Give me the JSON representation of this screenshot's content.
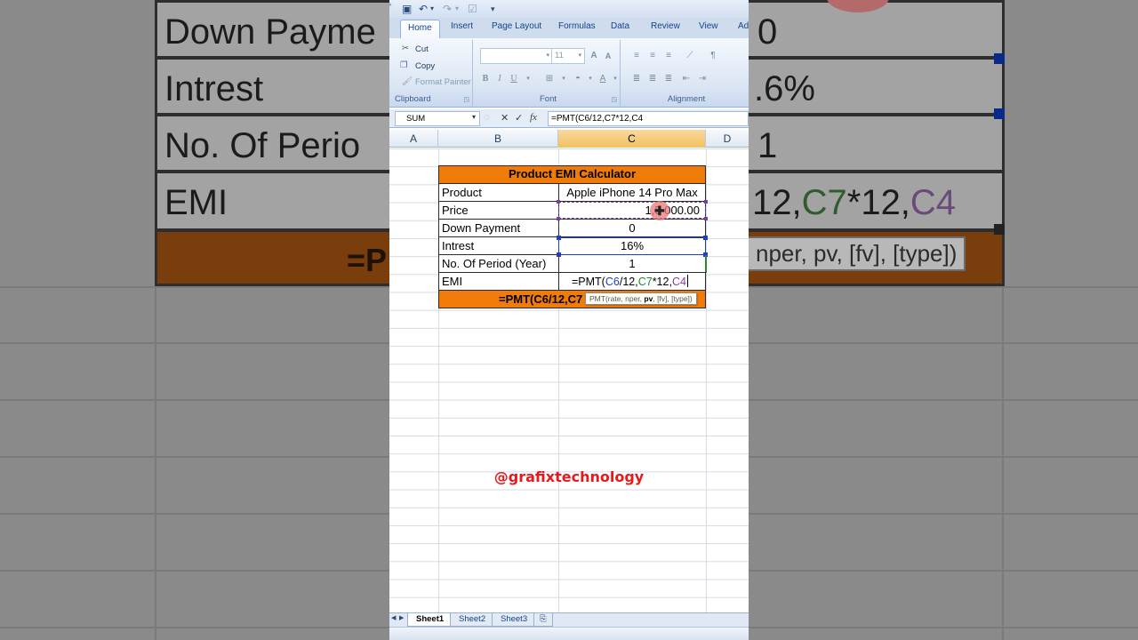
{
  "background_zoom": {
    "labels": [
      "Down Payme",
      "Intrest",
      "No. Of Perio",
      "EMI"
    ],
    "values": [
      "0",
      ".6%",
      "1"
    ],
    "formula_parts": {
      "a": "12,",
      "b": "C7",
      "c": "*12,",
      "d": "C4"
    },
    "tooltip": "nper, pv, [fv], [type])",
    "orange_text": "=P"
  },
  "qat": {
    "save_icon": "save-icon",
    "undo_icon": "undo-icon",
    "redo_icon": "redo-icon",
    "more": "▾"
  },
  "tabs": [
    "Home",
    "Insert",
    "Page Layout",
    "Formulas",
    "Data",
    "Review",
    "View",
    "Ad"
  ],
  "ribbon": {
    "clipboard": {
      "cut": "Cut",
      "copy": "Copy",
      "format_painter": "Format Painter",
      "label": "Clipboard"
    },
    "font": {
      "size": "11",
      "label": "Font",
      "grow": "A",
      "shrink": "A",
      "bold": "B",
      "italic": "I",
      "underline": "U"
    },
    "alignment": {
      "label": "Alignment"
    }
  },
  "formula_bar": {
    "name_box": "SUM",
    "formula": "=PMT(C6/12,C7*12,C4"
  },
  "columns": [
    "A",
    "B",
    "C",
    "D"
  ],
  "table": {
    "title": "Product EMI Calculator",
    "rows": [
      {
        "label": "Product",
        "value": "Apple iPhone 14 Pro Max"
      },
      {
        "label": "Price",
        "value": "1,5 000.00"
      },
      {
        "label": "Down Payment",
        "value": "0"
      },
      {
        "label": "Intrest",
        "value": "16%"
      },
      {
        "label": "No. Of Period (Year)",
        "value": "1"
      },
      {
        "label": "EMI",
        "value": ""
      }
    ],
    "edit": {
      "prefix": "=PMT(",
      "r1": "C6",
      "sep1": "/12,",
      "r2": "C7",
      "sep2": "*12,",
      "r3": "C4"
    },
    "tooltip": {
      "pre": "PMT(rate, nper, ",
      "bold": "pv",
      "post": ", [fv], [type])"
    },
    "orange_formula": "=PMT(C6/12,C7"
  },
  "watermark": "@grafixtechnology",
  "sheets": [
    "Sheet1",
    "Sheet2",
    "Sheet3"
  ],
  "colors": {
    "accent_orange": "#f07b09",
    "selection_blue": "#1f3fbf",
    "watermark_red": "#e8191a"
  }
}
